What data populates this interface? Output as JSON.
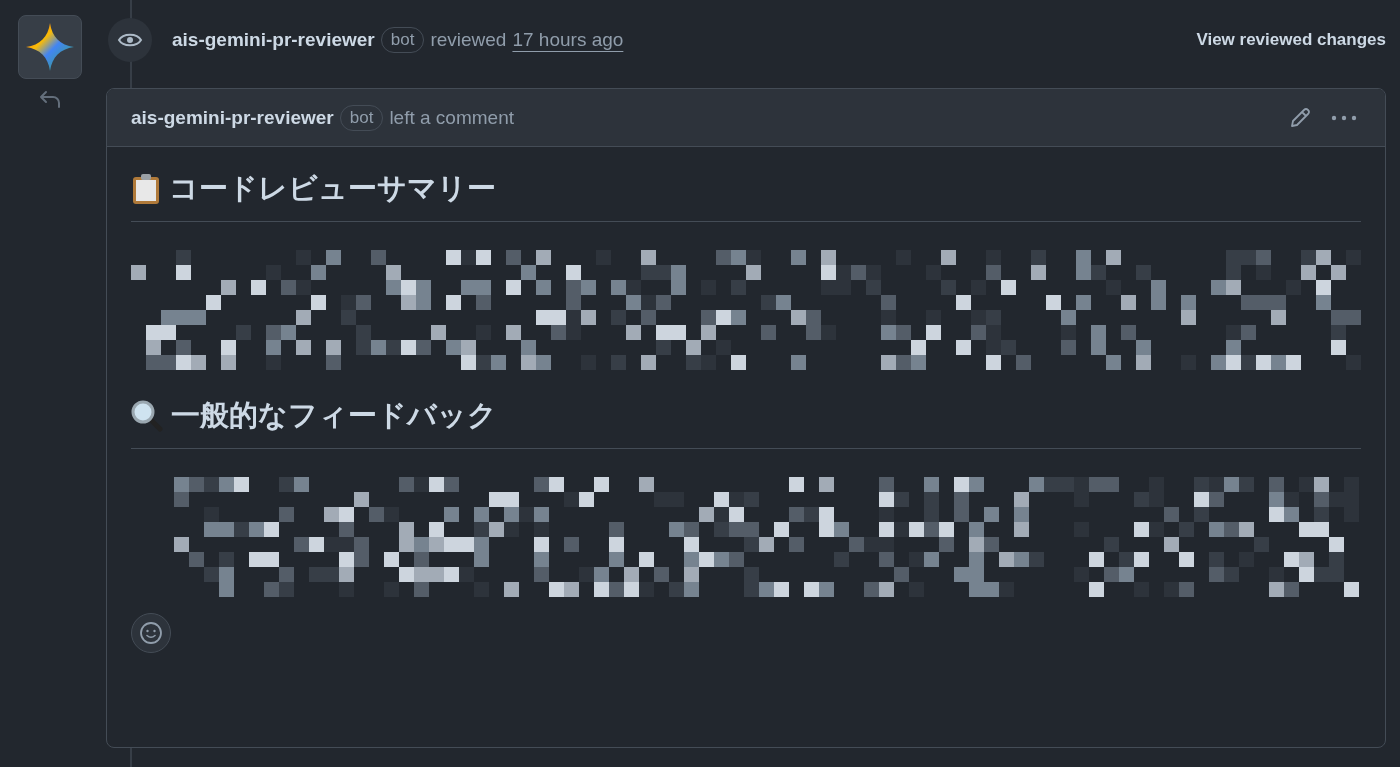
{
  "review": {
    "author": "ais-gemini-pr-reviewer",
    "badge": "bot",
    "action": "reviewed",
    "time": "17 hours ago",
    "link": "View reviewed changes"
  },
  "comment": {
    "author": "ais-gemini-pr-reviewer",
    "badge": "bot",
    "action": "left a comment",
    "sections": [
      {
        "heading": "コードレビューサマリー",
        "body": {
          "kind": "pixelated"
        }
      },
      {
        "heading": "一般的なフィードバック",
        "body": {
          "kind": "pixelated"
        }
      }
    ]
  }
}
